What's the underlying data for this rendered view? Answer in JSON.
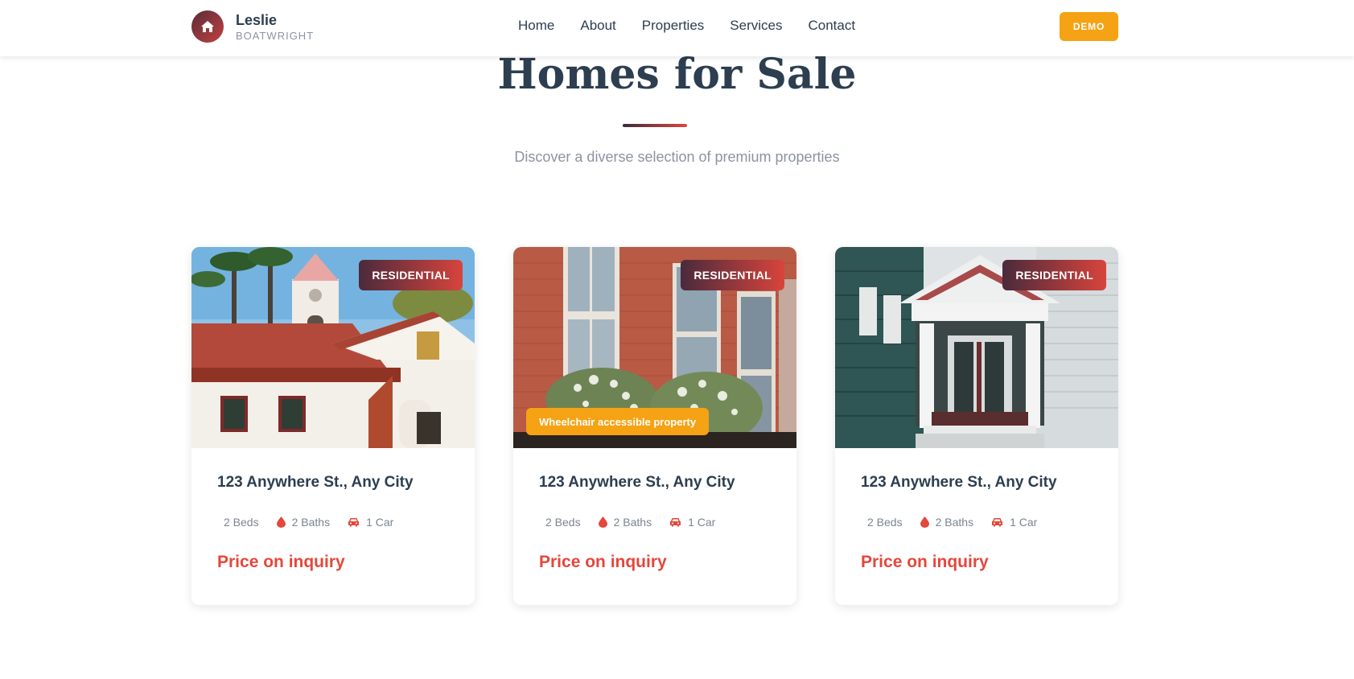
{
  "brand": {
    "first": "Leslie",
    "last": "BOATWRIGHT",
    "logo_icon": "house-icon"
  },
  "nav": {
    "items": [
      "Home",
      "About",
      "Properties",
      "Services",
      "Contact"
    ],
    "demo_label": "DEMO"
  },
  "section": {
    "title": "Homes for Sale",
    "subtitle": "Discover a diverse selection of premium properties"
  },
  "colors": {
    "accent": "#e4473b",
    "cta": "#f5a214",
    "text": "#2c3e50",
    "muted": "#8a94a0"
  },
  "cards": [
    {
      "tag": "RESIDENTIAL",
      "badge": "",
      "address": "123 Anywhere St., Any City",
      "beds": "2 Beds",
      "baths": "2 Baths",
      "car": "1 Car",
      "price": "Price on inquiry"
    },
    {
      "tag": "RESIDENTIAL",
      "badge": "Wheelchair accessible property",
      "address": "123 Anywhere St., Any City",
      "beds": "2 Beds",
      "baths": "2 Baths",
      "car": "1 Car",
      "price": "Price on inquiry"
    },
    {
      "tag": "RESIDENTIAL",
      "badge": "",
      "address": "123 Anywhere St., Any City",
      "beds": "2 Beds",
      "baths": "2 Baths",
      "car": "1 Car",
      "price": "Price on inquiry"
    }
  ]
}
